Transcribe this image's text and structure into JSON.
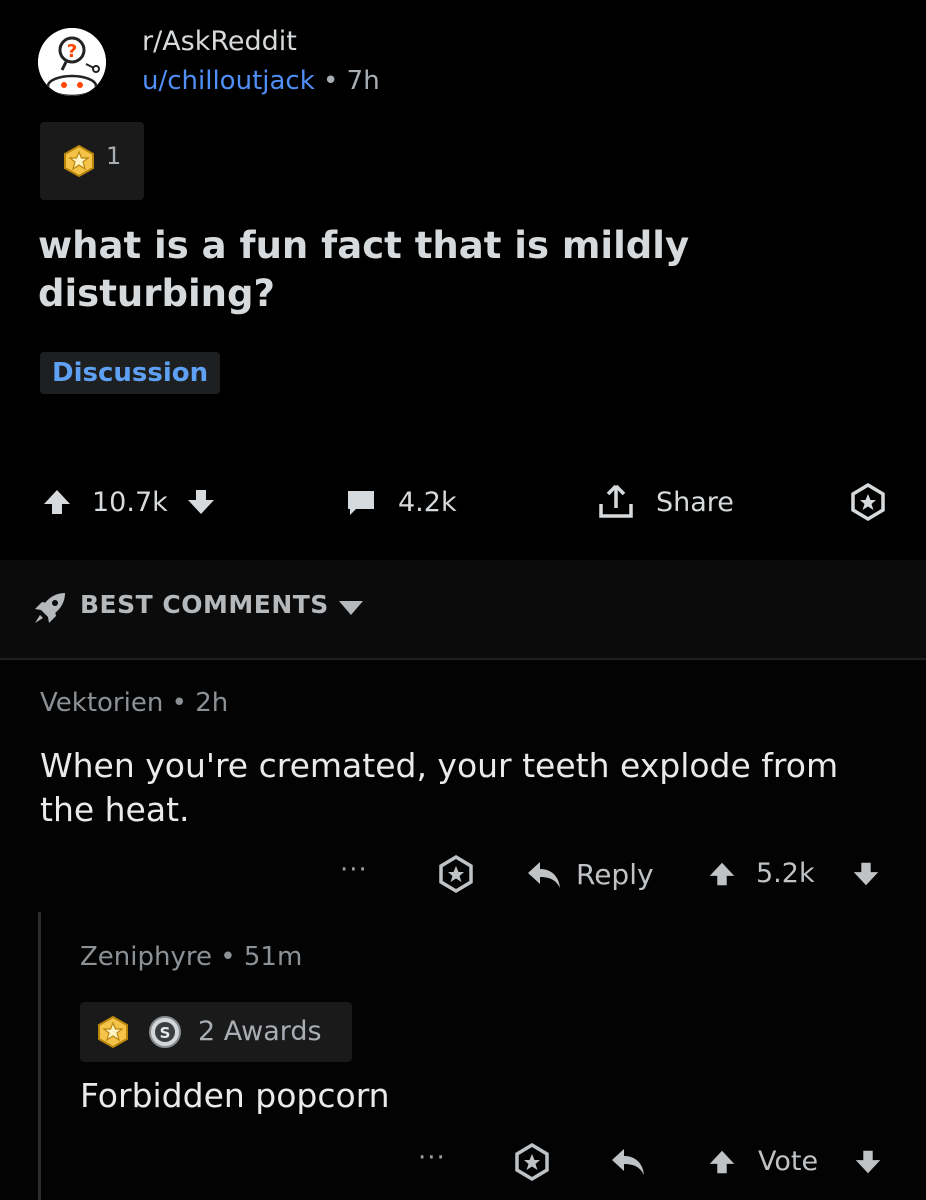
{
  "post": {
    "subreddit": "r/AskReddit",
    "author": "u/chilloutjack",
    "age": "7h",
    "award_count": "1",
    "title": "what is a fun fact that is mildly disturbing?",
    "flair": "Discussion",
    "upvotes": "10.7k",
    "comments": "4.2k",
    "share_label": "Share"
  },
  "sort": {
    "label": "BEST COMMENTS"
  },
  "comments": [
    {
      "author": "Vektorien",
      "age": "2h",
      "body": "When you're cremated, your teeth explode from the heat.",
      "reply_label": "Reply",
      "score": "5.2k"
    },
    {
      "author": "Zeniphyre",
      "age": "51m",
      "awards": "2 Awards",
      "body": "Forbidden popcorn",
      "score": "Vote"
    }
  ],
  "colors": {
    "background": "#030303",
    "link": "#4f8ff7",
    "flair": "#5ea0f2",
    "text": "#d7dadc"
  }
}
